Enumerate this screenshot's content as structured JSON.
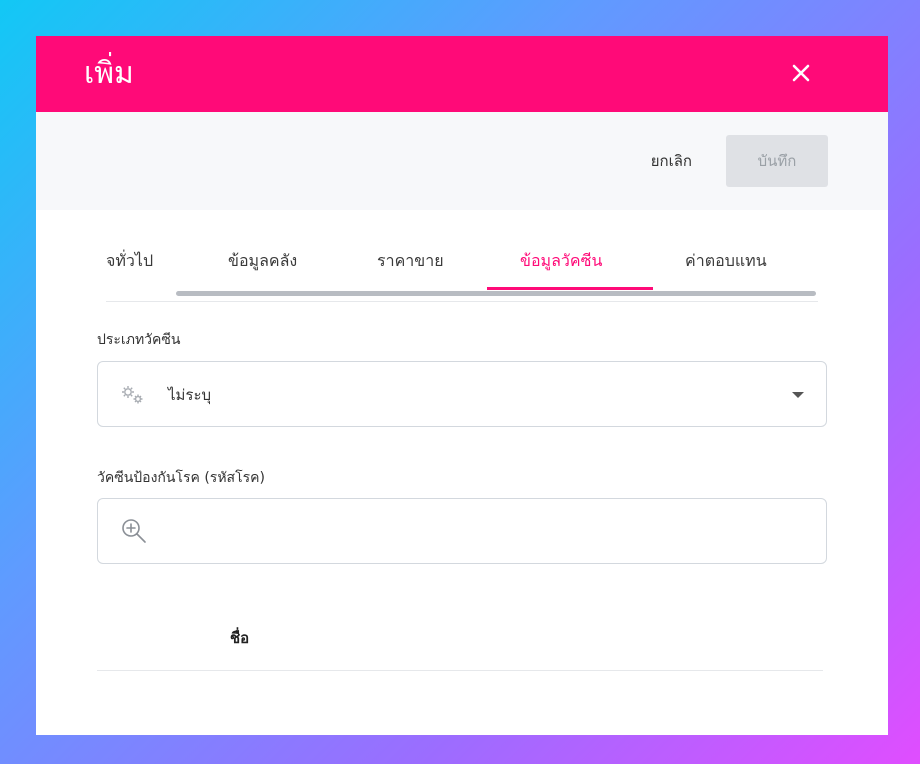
{
  "modal": {
    "title": "เพิ่ม",
    "close_icon": "close-icon"
  },
  "toolbar": {
    "cancel_label": "ยกเลิก",
    "save_label": "บันทึก"
  },
  "tabs": [
    {
      "label": "จทั่วไป",
      "active": false
    },
    {
      "label": "ข้อมูลคลัง",
      "active": false
    },
    {
      "label": "ราคาขาย",
      "active": false
    },
    {
      "label": "ข้อมูลวัคซีน",
      "active": true
    },
    {
      "label": "ค่าตอบแทน",
      "active": false
    }
  ],
  "form": {
    "vaccine_type_label": "ประเภทวัคซีน",
    "vaccine_type_value": "ไม่ระบุ",
    "vaccine_type_icon": "gears-icon",
    "disease_label": "วัคซีนป้องกันโรค (รหัสโรค)",
    "disease_search_icon": "zoom-in-icon",
    "disease_search_value": ""
  },
  "table": {
    "columns": [
      "ชื่อ"
    ]
  },
  "colors": {
    "brand": "#ff0a78",
    "save_disabled_bg": "#dfe1e5",
    "save_disabled_text": "#9aa0a6"
  }
}
